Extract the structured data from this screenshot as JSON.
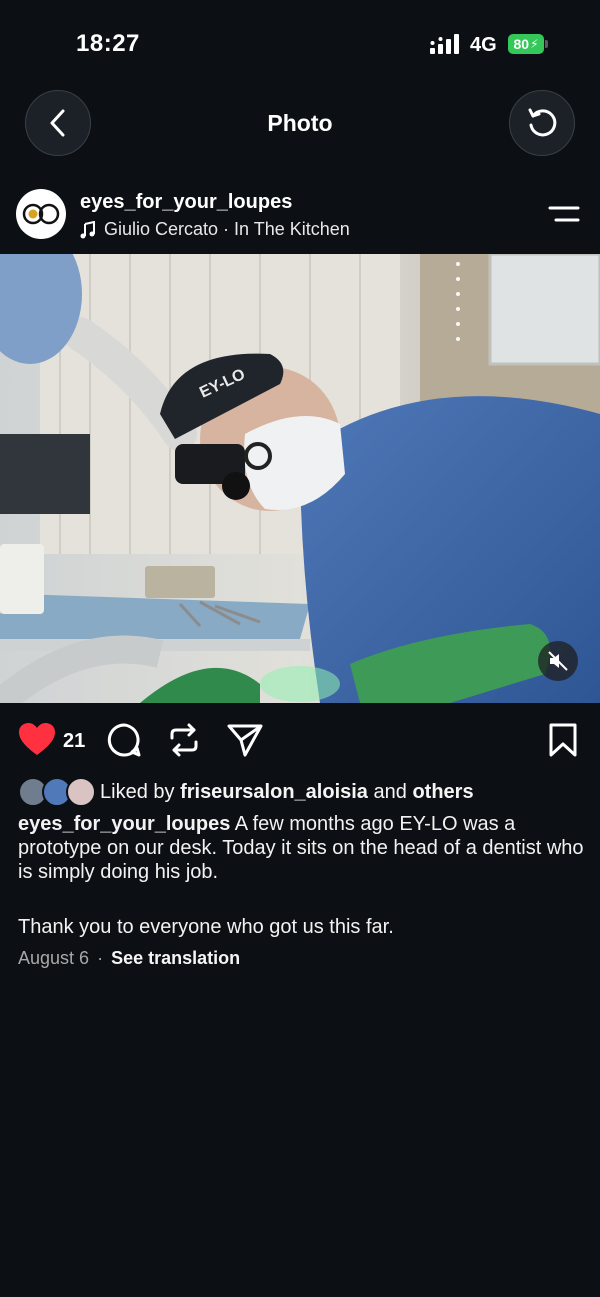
{
  "status_bar": {
    "time": "18:27",
    "network": "4G",
    "battery": "80"
  },
  "header": {
    "title": "Photo",
    "back_icon": "chevron-left-icon",
    "refresh_icon": "refresh-icon"
  },
  "post": {
    "username": "eyes_for_your_loupes",
    "music": "Giulio Cercato · In The Kitchen",
    "photo_badge": "EY-LO",
    "like_count": "21",
    "liked_by_prefix": "Liked by",
    "liked_by_user": "friseursalon_aloisia",
    "liked_by_and": "and",
    "liked_by_others": "others",
    "caption_user": "eyes_for_your_loupes",
    "caption_text": "A few months ago EY-LO was a prototype on our desk. Today it sits on the head of a dentist who is simply doing his job.",
    "caption_text_2": "Thank you to everyone who got us this far.",
    "date": "August 6",
    "separator": "·",
    "see_translation": "See translation"
  },
  "colors": {
    "background": "#0c1014",
    "like_red": "#ff3040",
    "battery_green": "#34c759"
  }
}
